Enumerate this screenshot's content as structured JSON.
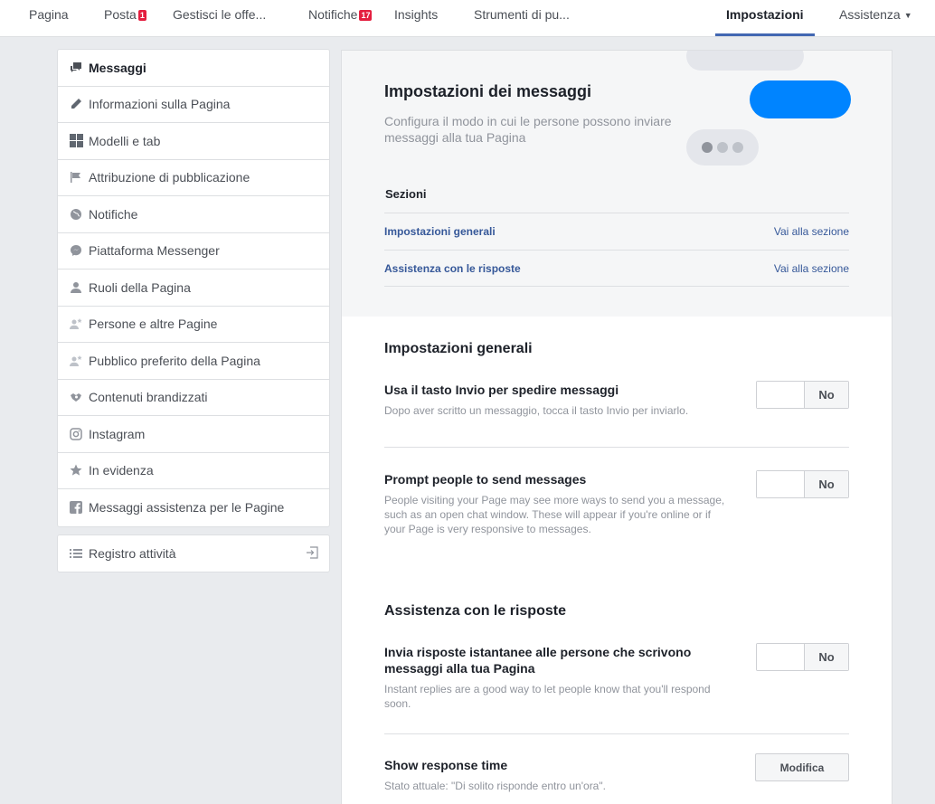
{
  "topnav": {
    "tabs": [
      {
        "label": "Pagina"
      },
      {
        "label": "Posta",
        "badge": "1"
      },
      {
        "label": "Gestisci le offe..."
      },
      {
        "label": "Notifiche",
        "badge": "17"
      },
      {
        "label": "Insights"
      },
      {
        "label": "Strumenti di pu..."
      },
      {
        "label": "Impostazioni",
        "active": true
      },
      {
        "label": "Assistenza"
      }
    ]
  },
  "sidebar": {
    "items": [
      {
        "label": "Messaggi",
        "icon": "messages-icon",
        "active": true
      },
      {
        "label": "Informazioni sulla Pagina",
        "icon": "pencil-icon"
      },
      {
        "label": "Modelli e tab",
        "icon": "grid-icon"
      },
      {
        "label": "Attribuzione di pubblicazione",
        "icon": "flag-icon"
      },
      {
        "label": "Notifiche",
        "icon": "globe-icon"
      },
      {
        "label": "Piattaforma Messenger",
        "icon": "messenger-icon"
      },
      {
        "label": "Ruoli della Pagina",
        "icon": "person-icon"
      },
      {
        "label": "Persone e altre Pagine",
        "icon": "person-star-icon"
      },
      {
        "label": "Pubblico preferito della Pagina",
        "icon": "person-star-icon"
      },
      {
        "label": "Contenuti brandizzati",
        "icon": "handshake-icon"
      },
      {
        "label": "Instagram",
        "icon": "instagram-icon"
      },
      {
        "label": "In evidenza",
        "icon": "star-icon"
      },
      {
        "label": "Messaggi assistenza per le Pagine",
        "icon": "facebook-icon"
      }
    ],
    "activity_log": {
      "label": "Registro attività",
      "icon": "list-icon"
    }
  },
  "main": {
    "title": "Impostazioni dei messaggi",
    "subtitle": "Configura il modo in cui le persone possono inviare messaggi alla tua Pagina",
    "sections_label": "Sezioni",
    "sections": [
      {
        "name": "Impostazioni generali",
        "link": "Vai alla sezione"
      },
      {
        "name": "Assistenza con le risposte",
        "link": "Vai alla sezione"
      }
    ],
    "general": {
      "title": "Impostazioni generali",
      "settings": [
        {
          "label": "Usa il tasto Invio per spedire messaggi",
          "desc": "Dopo aver scritto un messaggio, tocca il tasto Invio per inviarlo.",
          "state": "No"
        },
        {
          "label": "Prompt people to send messages",
          "desc": "People visiting your Page may see more ways to send you a message, such as an open chat window. These will appear if you're online or if your Page is very responsive to messages.",
          "state": "No"
        }
      ]
    },
    "assist": {
      "title": "Assistenza con le risposte",
      "settings": [
        {
          "label": "Invia risposte istantanee alle persone che scrivono messaggi alla tua Pagina",
          "desc": "Instant replies are a good way to let people know that you'll respond soon.",
          "state": "No"
        },
        {
          "label": "Show response time",
          "desc": "Stato attuale: \"Di solito risponde entro un'ora\".",
          "button": "Modifica"
        }
      ]
    }
  }
}
